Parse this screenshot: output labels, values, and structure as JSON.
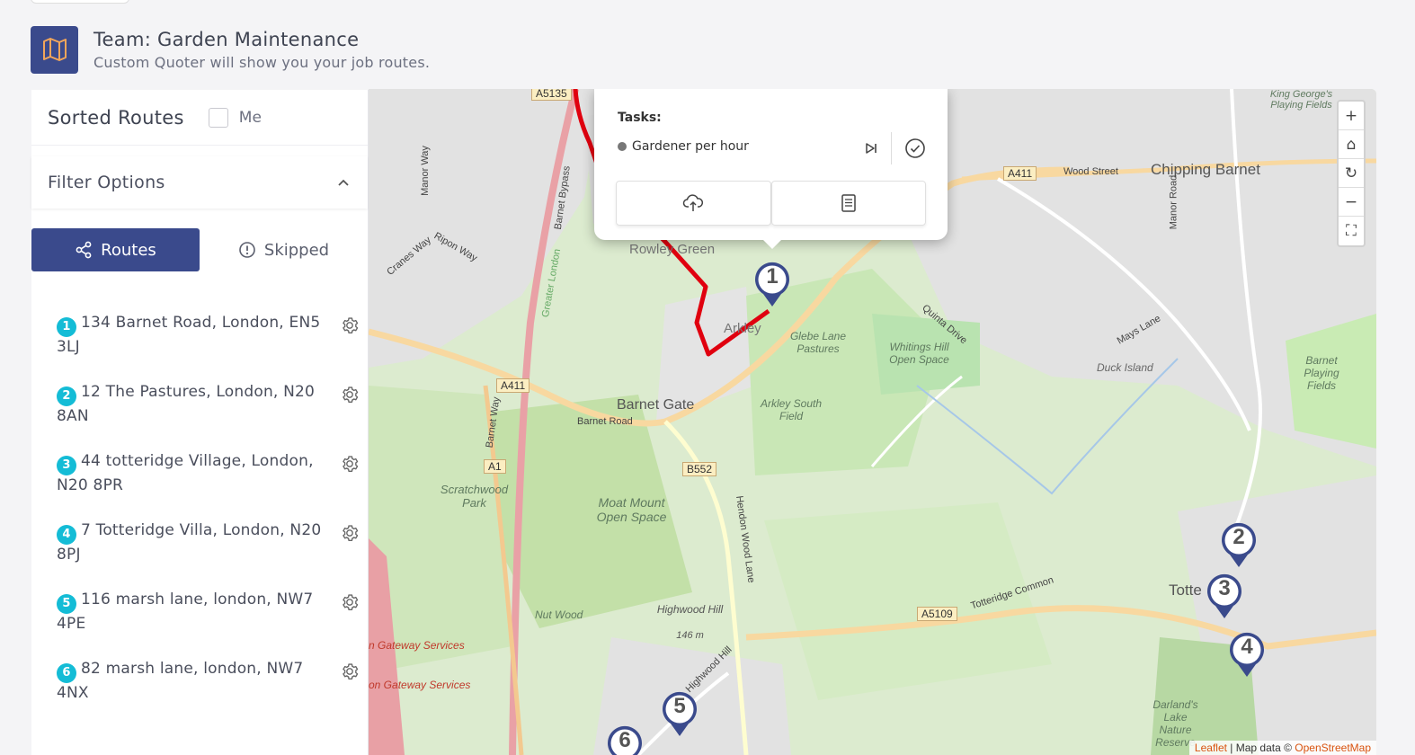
{
  "header": {
    "title": "Team: Garden Maintenance",
    "subtitle": "Custom Quoter will show you your job routes."
  },
  "panel": {
    "title": "Sorted Routes",
    "me_label": "Me",
    "me_checked": false,
    "filter_label": "Filter Options",
    "tabs": [
      {
        "label": "Routes",
        "active": true,
        "icon": "share-icon"
      },
      {
        "label": "Skipped",
        "active": false,
        "icon": "alert-circle-icon"
      }
    ],
    "routes": [
      {
        "num": "1",
        "address": "134 Barnet Road, London, EN5 3LJ"
      },
      {
        "num": "2",
        "address": "12 The Pastures, London, N20 8AN"
      },
      {
        "num": "3",
        "address": "44 totteridge Village, London, N20 8PR"
      },
      {
        "num": "4",
        "address": "7 Totteridge Villa, London, N20 8PJ"
      },
      {
        "num": "5",
        "address": "116 marsh lane, london, NW7 4PE"
      },
      {
        "num": "6",
        "address": "82 marsh lane, london, NW7 4NX"
      }
    ]
  },
  "popup": {
    "tasks_label": "Tasks:",
    "task": "Gardener per hour"
  },
  "map": {
    "markers": [
      "1",
      "2",
      "3",
      "4",
      "5",
      "6"
    ],
    "labels": {
      "chipping_barnet": "Chipping Barnet",
      "barnet_gate": "Barnet Gate",
      "rowley_green": "Rowley Green",
      "arkley": "Arkley",
      "totte": "Totte",
      "glebe": "Glebe Lane Pastures",
      "whitings": "Whitings Hill Open Space",
      "arkley_south": "Arkley South Field",
      "scratchwood": "Scratchwood Park",
      "moat_mount": "Moat Mount Open Space",
      "highwood": "Highwood Hill",
      "highwood_elev": "146 m",
      "nut_wood": "Nut Wood",
      "darlands": "Darland's Lake Nature Reserve",
      "duck_island": "Duck Island",
      "barnet_playing": "Barnet Playing Fields",
      "king_georges": "King George's Playing Fields",
      "wood_street": "Wood Street",
      "barnet_road": "Barnet Road",
      "totteridge_common": "Totteridge Common",
      "mays_lane": "Mays Lane",
      "quinta_drive": "Quinta Drive",
      "manor_road": "Manor Road",
      "ripon_way": "Ripon Way",
      "cranes_way": "Cranes Way",
      "manor_way": "Manor Way",
      "barnet_bypass": "Barnet Bypass",
      "barnet_way": "Barnet Way",
      "hendon_wood_lane": "Hendon Wood Lane",
      "highwood_hill_road": "Highwood Hill",
      "gateway1": "n Gateway Services",
      "gateway2": "on Gateway Services",
      "greater_london": "Greater London"
    },
    "shields": {
      "a5135": "A5135",
      "a411_top": "A411",
      "a411_left": "A411",
      "a1": "A1",
      "b552": "B552",
      "a5109": "A5109"
    },
    "controls": [
      "+",
      "⌂",
      "↻",
      "−",
      "⛶"
    ],
    "attribution": {
      "leaflet": "Leaflet",
      "sep": " | Map data © ",
      "osm": "OpenStreetMap"
    },
    "colors": {
      "route": "#e0000f",
      "marker": "#3a4a8c",
      "land": "#dcebcf",
      "urban": "#e2e2e2"
    }
  }
}
